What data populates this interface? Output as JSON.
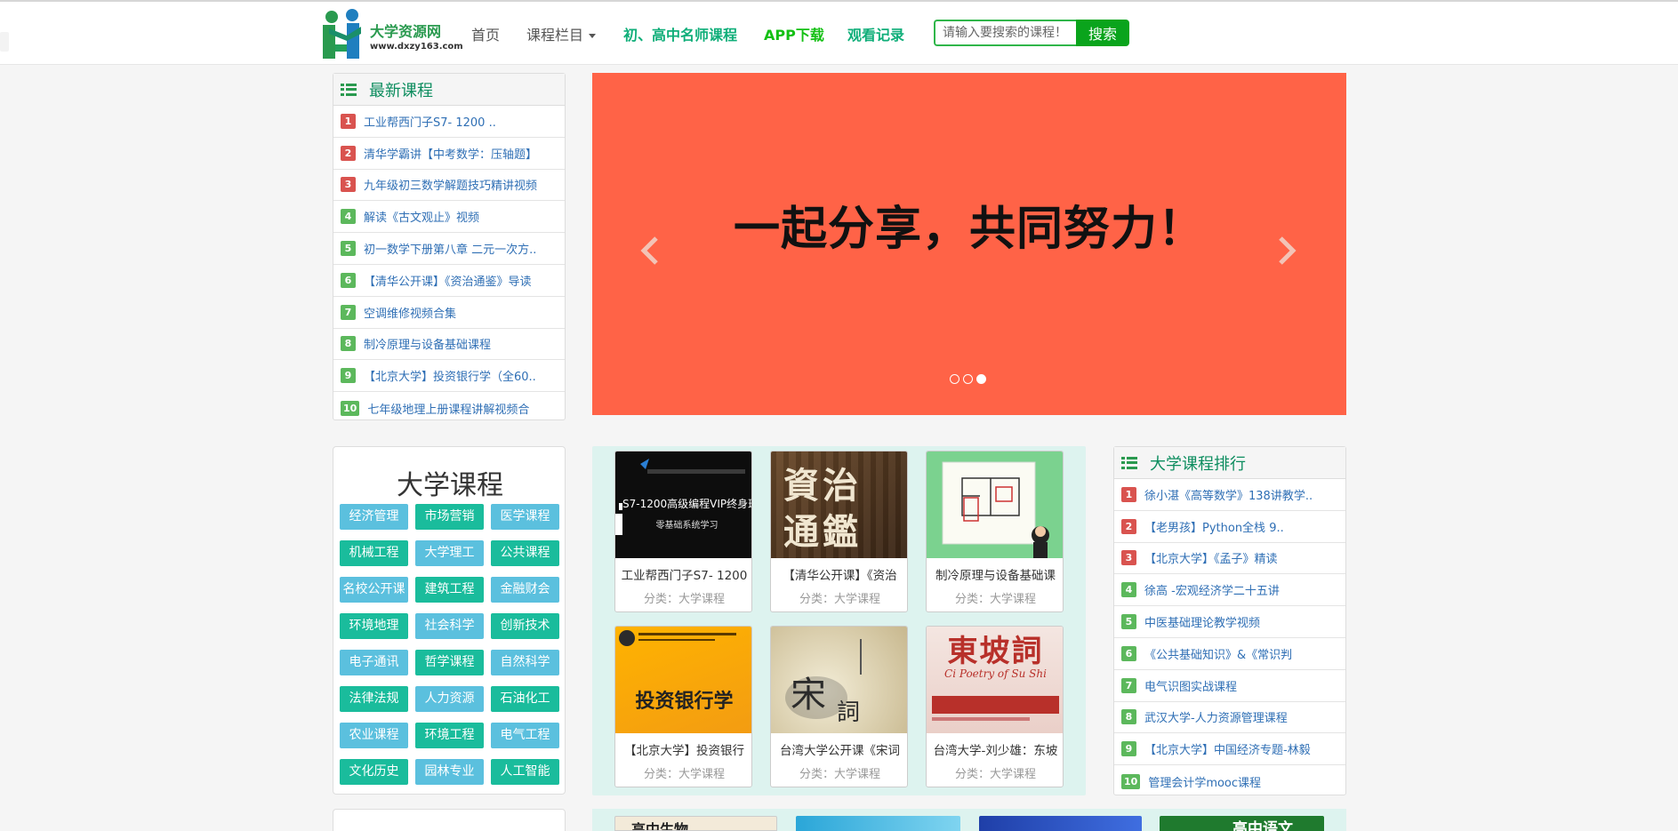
{
  "header": {
    "logo_title": "大学资源网",
    "logo_url": "www.dxzy163.com",
    "nav": {
      "home": "首页",
      "course_menu": "课程栏目",
      "teachers": "初、高中名师课程",
      "app": "APP下载",
      "history": "观看记录"
    },
    "search": {
      "placeholder": "请输入要搜索的课程！",
      "button": "搜索"
    }
  },
  "latest": {
    "title": "最新课程",
    "items": [
      {
        "rank": "1",
        "text": "工业帮西门子S7- 1200 .."
      },
      {
        "rank": "2",
        "text": "清华学霸讲【中考数学：压轴题】"
      },
      {
        "rank": "3",
        "text": "九年级初三数学解题技巧精讲视频"
      },
      {
        "rank": "4",
        "text": "解读《古文观止》视频"
      },
      {
        "rank": "5",
        "text": "初一数学下册第八章 二元一次方.."
      },
      {
        "rank": "6",
        "text": "【清华公开课】《资治通鉴》导读"
      },
      {
        "rank": "7",
        "text": "空调维修视频合集"
      },
      {
        "rank": "8",
        "text": "制冷原理与设备基础课程"
      },
      {
        "rank": "9",
        "text": "【北京大学】投资银行学（全60.."
      },
      {
        "rank": "10",
        "text": "七年级地理上册课程讲解视频合"
      }
    ]
  },
  "carousel": {
    "slogan": "一起分享，共同努力！",
    "slides": 3,
    "active": 3
  },
  "categories": {
    "title": "大学课程",
    "items": [
      {
        "label": "经济管理",
        "color": "blue"
      },
      {
        "label": "市场营销",
        "color": "teal"
      },
      {
        "label": "医学课程",
        "color": "blue"
      },
      {
        "label": "机械工程",
        "color": "teal"
      },
      {
        "label": "大学理工",
        "color": "blue"
      },
      {
        "label": "公共课程",
        "color": "teal"
      },
      {
        "label": "名校公开课",
        "color": "blue"
      },
      {
        "label": "建筑工程",
        "color": "teal"
      },
      {
        "label": "金融财会",
        "color": "blue"
      },
      {
        "label": "环境地理",
        "color": "teal"
      },
      {
        "label": "社会科学",
        "color": "blue"
      },
      {
        "label": "创新技术",
        "color": "teal"
      },
      {
        "label": "电子通讯",
        "color": "blue"
      },
      {
        "label": "哲学课程",
        "color": "teal"
      },
      {
        "label": "自然科学",
        "color": "blue"
      },
      {
        "label": "法律法规",
        "color": "teal"
      },
      {
        "label": "人力资源",
        "color": "blue"
      },
      {
        "label": "石油化工",
        "color": "teal"
      },
      {
        "label": "农业课程",
        "color": "blue"
      },
      {
        "label": "环境工程",
        "color": "teal"
      },
      {
        "label": "电气工程",
        "color": "blue"
      },
      {
        "label": "文化历史",
        "color": "teal"
      },
      {
        "label": "园林专业",
        "color": "blue"
      },
      {
        "label": "人工智能",
        "color": "teal"
      }
    ]
  },
  "courses": [
    {
      "title": "工业帮西门子S7- 1200",
      "category": "分类：大学课程",
      "thumb_text_1": "S7-1200高级编程VIP终身班",
      "thumb_text_2": "零基础系统学习"
    },
    {
      "title": "【清华公开课】《资治",
      "category": "分类：大学课程",
      "thumb_text_1": "資治",
      "thumb_text_2": "通鑑"
    },
    {
      "title": "制冷原理与设备基础课",
      "category": "分类：大学课程"
    },
    {
      "title": "【北京大学】投资银行",
      "category": "分类：大学课程",
      "thumb_text_1": "投资银行学"
    },
    {
      "title": "台湾大学公开课《宋词",
      "category": "分类：大学课程",
      "thumb_text_1": "宋",
      "thumb_text_2": "詞"
    },
    {
      "title": "台湾大学-刘少雄：东坡",
      "category": "分类：大学课程",
      "thumb_text_1": "東坡詞",
      "thumb_text_2": "Ci Poetry of Su Shi"
    }
  ],
  "ranking": {
    "title": "大学课程排行",
    "items": [
      {
        "rank": "1",
        "text": "徐小湛《高等数学》138讲教学.."
      },
      {
        "rank": "2",
        "text": "【老男孩】Python全栈 9.."
      },
      {
        "rank": "3",
        "text": "【北京大学】《孟子》精读"
      },
      {
        "rank": "4",
        "text": "徐高 -宏观经济学二十五讲"
      },
      {
        "rank": "5",
        "text": "中医基础理论教学视频"
      },
      {
        "rank": "6",
        "text": "《公共基础知识》&《常识判"
      },
      {
        "rank": "7",
        "text": "电气识图实战课程"
      },
      {
        "rank": "8",
        "text": "武汉大学-人力资源管理课程"
      },
      {
        "rank": "9",
        "text": "【北京大学】中国经济专题-林毅"
      },
      {
        "rank": "10",
        "text": "管理会计学mooc课程"
      }
    ]
  },
  "bottom_peek": {
    "left_label": "高中生物",
    "right_label": "高中语文"
  }
}
